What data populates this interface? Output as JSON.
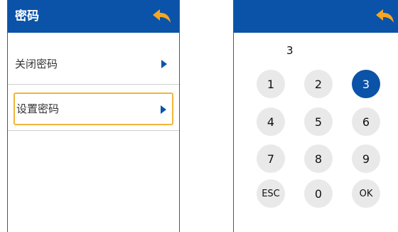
{
  "left_screen": {
    "title": "密码",
    "back_icon": "back-arrow-icon",
    "menu": [
      {
        "label": "关闭密码",
        "icon": "chevron-right-icon",
        "selected": false
      },
      {
        "label": "设置密码",
        "icon": "chevron-right-icon",
        "selected": true
      }
    ]
  },
  "right_screen": {
    "back_icon": "back-arrow-icon",
    "password_display": "3",
    "keys": [
      {
        "label": "1"
      },
      {
        "label": "2"
      },
      {
        "label": "3",
        "active": true
      },
      {
        "label": "4"
      },
      {
        "label": "5"
      },
      {
        "label": "6"
      },
      {
        "label": "7"
      },
      {
        "label": "8"
      },
      {
        "label": "9"
      },
      {
        "label": "ESC"
      },
      {
        "label": "0"
      },
      {
        "label": "OK"
      }
    ]
  },
  "colors": {
    "header_blue": "#0b53a8",
    "back_arrow_orange": "#f5a623",
    "selection_border": "#f2b43c",
    "key_gray": "#e9e9e9"
  }
}
